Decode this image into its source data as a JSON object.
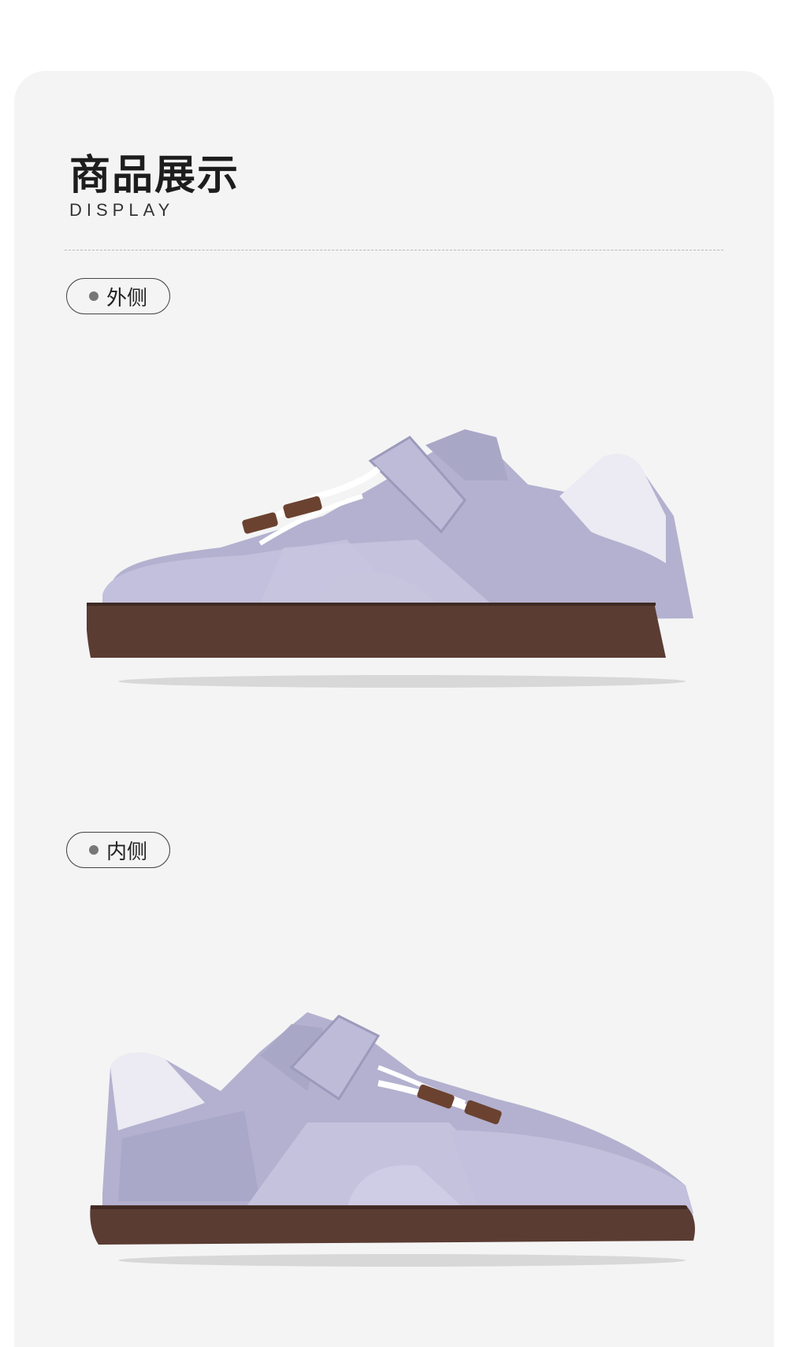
{
  "section": {
    "title": "商品展示",
    "subtitle": "DISPLAY"
  },
  "views": [
    {
      "label": "外侧",
      "image": "shoe-lateral-view"
    },
    {
      "label": "内侧",
      "image": "shoe-medial-view"
    }
  ],
  "colors": {
    "upper": "#b3b1cf",
    "sole": "#5a3c33",
    "heel": "#eaeaf2",
    "lace_tabs": "#6b4230",
    "background": "#f4f4f4"
  }
}
